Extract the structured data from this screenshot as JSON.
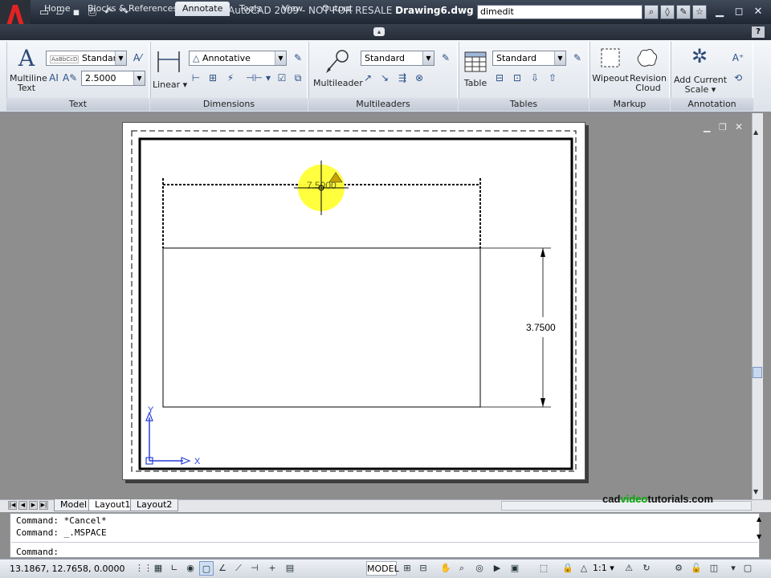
{
  "title_bar": {
    "app_title": "AutoCAD 2009 - NOT FOR RESALE",
    "document_name": "Drawing6.dwg",
    "search_value": "dimedit"
  },
  "tabs": [
    "Home",
    "Blocks & References",
    "Annotate",
    "Tools",
    "View",
    "Output"
  ],
  "active_tab": "Annotate",
  "panels": {
    "text": {
      "title": "Text",
      "big_button": "Multiline Text",
      "style_value": "Standard",
      "style_preview": "AaBbCcD",
      "height_value": "2.5000"
    },
    "dimensions": {
      "title": "Dimensions",
      "big_button": "Linear",
      "style_value": "Annotative"
    },
    "multileaders": {
      "title": "Multileaders",
      "big_button": "Multileader",
      "style_value": "Standard"
    },
    "tables": {
      "title": "Tables",
      "big_button": "Table",
      "style_value": "Standard"
    },
    "markup": {
      "title": "Markup",
      "wipeout": "Wipeout",
      "revision_cloud": "Revision Cloud"
    },
    "annotation_scaling": {
      "title": "Annotation Scaling",
      "add_scale": "Add Current Scale"
    }
  },
  "drawing": {
    "vertical_dim_text": "3.7500",
    "horizontal_dim_text": "7.5000",
    "ucs_x": "X",
    "ucs_y": "Y"
  },
  "layout_tabs": [
    "Model",
    "Layout1",
    "Layout2"
  ],
  "active_layout": "Layout1",
  "watermark": {
    "prefix": "cad",
    "highlight": "video",
    "suffix": "tutorials.com"
  },
  "command": {
    "history": [
      "Command: *Cancel*",
      "Command: _.MSPACE"
    ],
    "prompt": "Command:"
  },
  "status": {
    "coordinates": "13.1867, 12.7658, 0.0000",
    "space": "MODEL",
    "annotation_scale": "1:1"
  },
  "colors": {
    "title_bar": "#2b3441",
    "ribbon": "#e6eaf0",
    "drawing_bg": "#8e8e8e",
    "highlight_circle": "#ffff33",
    "ucs_blue": "#2a3fd6"
  }
}
